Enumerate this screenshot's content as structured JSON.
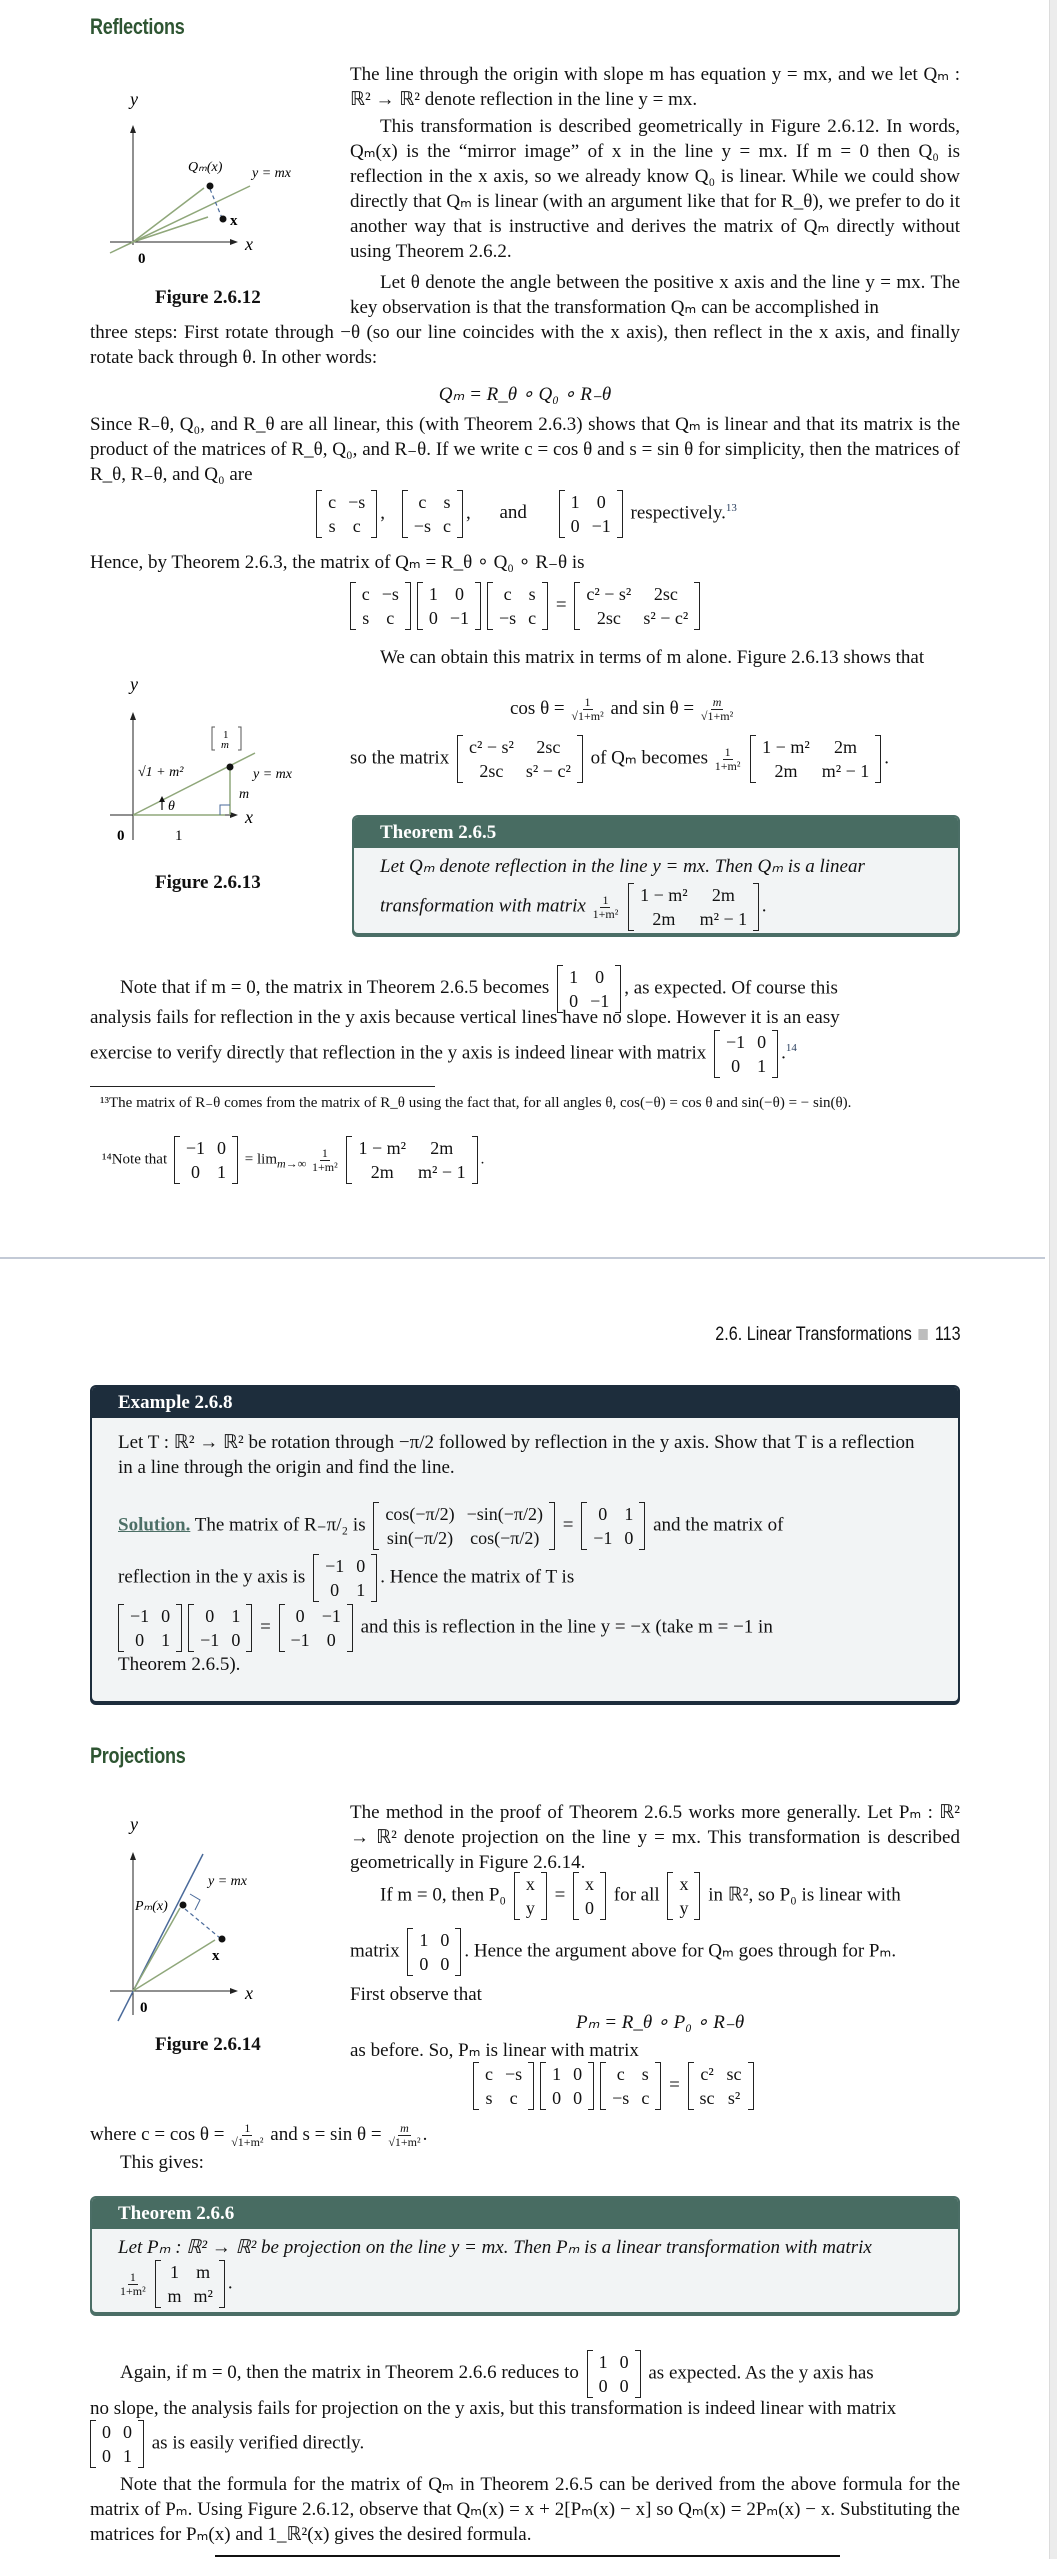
{
  "page1": {
    "section_title": "Reflections",
    "fig12": {
      "caption": "Figure 2.6.12",
      "labels": {
        "y": "y",
        "x": "x",
        "origin": "0",
        "qm": "Q_m(x)",
        "line": "y = mx",
        "point": "x"
      }
    },
    "p1": "The line through the origin with slope m has equation y = mx, and we let Qₘ : ℝ² → ℝ² denote reflection in the line y = mx.",
    "p2": "This transformation is described geometrically in Figure 2.6.12. In words, Qₘ(x) is the “mirror image” of x in the line y = mx. If m = 0 then Q₀ is reflection in the x axis, so we already know Q₀ is linear. While we could show directly that Qₘ is linear (with an argument like that for R_θ), we prefer to do it another way that is instructive and derives the matrix of Qₘ directly without using Theorem 2.6.2.",
    "p3a": "Let θ denote the angle between the positive x axis and the line y = mx. The key observation is that the transformation Qₘ can be accomplished in",
    "p3b": "three steps: First rotate through −θ (so our line coincides with the x axis), then reflect in the x axis, and finally rotate back through θ. In other words:",
    "eq1": "Qₘ = R_θ ∘ Q₀ ∘ R₋θ",
    "p4": "Since R₋θ, Q₀, and R_θ are all linear, this (with Theorem 2.6.3) shows that Qₘ is linear and that its matrix is the product of the matrices of R_θ, Q₀, and R₋θ. If we write c = cos θ and s = sin θ for simplicity, then the matrices of R_θ, R₋θ, and Q₀ are",
    "matrices_row": {
      "m1": [
        [
          "c",
          "−s"
        ],
        [
          "s",
          "c"
        ]
      ],
      "m2": [
        [
          "c",
          "s"
        ],
        [
          "−s",
          "c"
        ]
      ],
      "and": "and",
      "m3": [
        [
          "1",
          "0"
        ],
        [
          "0",
          "−1"
        ]
      ],
      "tail": "respectively.",
      "fn_mark": "13"
    },
    "p5": "Hence, by Theorem 2.6.3, the matrix of Qₘ = R_θ ∘ Q₀ ∘ R₋θ is",
    "product": {
      "a": [
        [
          "c",
          "−s"
        ],
        [
          "s",
          "c"
        ]
      ],
      "b": [
        [
          "1",
          "0"
        ],
        [
          "0",
          "−1"
        ]
      ],
      "c": [
        [
          "c",
          "s"
        ],
        [
          "−s",
          "c"
        ]
      ],
      "result": [
        [
          "c² − s²",
          "2sc"
        ],
        [
          "2sc",
          "s² − c²"
        ]
      ]
    },
    "p6": "We can obtain this matrix in terms of m alone. Figure 2.6.13 shows that",
    "cos_sin": {
      "cos_lhs": "cos θ =",
      "cos_num": "1",
      "cos_den": "√1+m²",
      "and": "and",
      "sin_lhs": "sin θ =",
      "sin_num": "m",
      "sin_den": "√1+m²"
    },
    "so_matrix": {
      "lead": "so the matrix",
      "m": [
        [
          "c² − s²",
          "2sc"
        ],
        [
          "2sc",
          "s² − c²"
        ]
      ],
      "mid": "of Qₘ becomes",
      "frac_num": "1",
      "frac_den": "1+m²",
      "result": [
        [
          "1 − m²",
          "2m"
        ],
        [
          "2m",
          "m² − 1"
        ]
      ]
    },
    "fig13": {
      "caption": "Figure 2.6.13",
      "labels": {
        "y": "y",
        "x": "x",
        "origin": "0",
        "one": "1",
        "vec_top": "1",
        "vec_bot": "m",
        "hyp": "√1 + m²",
        "line": "y = mx",
        "m": "m",
        "theta": "θ"
      }
    },
    "theorem265": {
      "title": "Theorem 2.6.5",
      "line1": "Let Qₘ denote reflection in the line y = mx. Then Qₘ is a linear",
      "line2": "transformation with matrix",
      "frac_num": "1",
      "frac_den": "1+m²",
      "matrix": [
        [
          "1 − m²",
          "2m"
        ],
        [
          "2m",
          "m² − 1"
        ]
      ]
    },
    "p7a": "Note that if m = 0, the matrix in Theorem 2.6.5 becomes",
    "p7_matrix": [
      [
        "1",
        "0"
      ],
      [
        "0",
        "−1"
      ]
    ],
    "p7b": ", as expected. Of course this",
    "p7c": "analysis fails for reflection in the y axis because vertical lines have no slope. However it is an easy",
    "p7d": "exercise to verify directly that reflection in the y axis is indeed linear with matrix",
    "p7_matrix2": [
      [
        "−1",
        "0"
      ],
      [
        "0",
        "1"
      ]
    ],
    "p7_fn_mark": "14",
    "fn13": "¹³The matrix of R₋θ comes from the matrix of R_θ using the fact that, for all angles θ, cos(−θ) = cos θ and sin(−θ) = − sin(θ).",
    "fn14": {
      "lead": "¹⁴Note that",
      "m1": [
        [
          "−1",
          "0"
        ],
        [
          "0",
          "1"
        ]
      ],
      "lim": "= lim",
      "lim_sub": "m→∞",
      "frac_num": "1",
      "frac_den": "1+m²",
      "m2": [
        [
          "1 − m²",
          "2m"
        ],
        [
          "2m",
          "m² − 1"
        ]
      ]
    }
  },
  "page2": {
    "running_head": "2.6. Linear Transformations",
    "page_number": "113",
    "example268": {
      "title": "Example 2.6.8",
      "statement": "Let T : ℝ² → ℝ² be rotation through −π/2 followed by reflection in the y axis. Show that T is a reflection in a line through the origin and find the line.",
      "solution_label": "Solution.",
      "sol_a": "The matrix of R₋π/₂ is",
      "rot_matrix": [
        [
          "cos(−π/2)",
          "−sin(−π/2)"
        ],
        [
          "sin(−π/2)",
          "cos(−π/2)"
        ]
      ],
      "rot_result": [
        [
          "0",
          "1"
        ],
        [
          "−1",
          "0"
        ]
      ],
      "sol_b": "and the matrix of",
      "sol_c": "reflection in the y axis is",
      "refl_matrix": [
        [
          "−1",
          "0"
        ],
        [
          "0",
          "1"
        ]
      ],
      "sol_d": ". Hence the matrix of T is",
      "prod_a": [
        [
          "−1",
          "0"
        ],
        [
          "0",
          "1"
        ]
      ],
      "prod_b": [
        [
          "0",
          "1"
        ],
        [
          "−1",
          "0"
        ]
      ],
      "prod_result": [
        [
          "0",
          "−1"
        ],
        [
          "−1",
          "0"
        ]
      ],
      "sol_e": "and this is reflection in the line y = −x (take m = −1 in",
      "sol_f": "Theorem 2.6.5)."
    },
    "section_title": "Projections",
    "fig14": {
      "caption": "Figure 2.6.14",
      "labels": {
        "y": "y",
        "x": "x",
        "origin": "0",
        "pm": "Pₘ(x)",
        "line": "y = mx",
        "point": "x"
      }
    },
    "q1": "The method in the proof of Theorem 2.6.5 works more generally. Let Pₘ : ℝ² → ℝ² denote projection on the line y = mx. This transformation is described geometrically in Figure 2.6.14.",
    "q2": {
      "lead": "If m = 0, then P₀",
      "v1": [
        [
          "x"
        ],
        [
          "y"
        ]
      ],
      "v2": [
        [
          "x"
        ],
        [
          "0"
        ]
      ],
      "forall": "for all",
      "v3": [
        [
          "x"
        ],
        [
          "y"
        ]
      ],
      "tail": "in ℝ², so P₀ is linear with"
    },
    "q3": {
      "lead": "matrix",
      "m": [
        [
          "1",
          "0"
        ],
        [
          "0",
          "0"
        ]
      ],
      "tail": ". Hence the argument above for Qₘ goes through for Pₘ."
    },
    "q4": "First observe that",
    "eq2": "Pₘ = R_θ ∘ P₀ ∘ R₋θ",
    "q5": "as before. So, Pₘ is linear with matrix",
    "product": {
      "a": [
        [
          "c",
          "−s"
        ],
        [
          "s",
          "c"
        ]
      ],
      "b": [
        [
          "1",
          "0"
        ],
        [
          "0",
          "0"
        ]
      ],
      "c": [
        [
          "c",
          "s"
        ],
        [
          "−s",
          "c"
        ]
      ],
      "result": [
        [
          "c²",
          "sc"
        ],
        [
          "sc",
          "s²"
        ]
      ]
    },
    "q6": {
      "lead": "where c = cos θ =",
      "c_num": "1",
      "c_den": "√1+m²",
      "mid": "and s = sin θ =",
      "s_num": "m",
      "s_den": "√1+m²"
    },
    "q7": "This gives:",
    "theorem266": {
      "title": "Theorem 2.6.6",
      "line1": "Let Pₘ : ℝ² → ℝ² be projection on the line y = mx. Then Pₘ is a linear transformation with matrix",
      "frac_num": "1",
      "frac_den": "1+m²",
      "matrix": [
        [
          "1",
          "m"
        ],
        [
          "m",
          "m²"
        ]
      ]
    },
    "r1a": "Again, if m = 0, then the matrix in Theorem 2.6.6 reduces to",
    "r1_matrix": [
      [
        "1",
        "0"
      ],
      [
        "0",
        "0"
      ]
    ],
    "r1b": "as expected. As the y axis has",
    "r1c": "no slope, the analysis fails for projection on the y axis, but this transformation is indeed linear with matrix",
    "r1_matrix2": [
      [
        "0",
        "0"
      ],
      [
        "0",
        "1"
      ]
    ],
    "r1d": "as is easily verified directly.",
    "r2": "Note that the formula for the matrix of Qₘ in Theorem 2.6.5 can be derived from the above formula for the matrix of Pₘ. Using Figure 2.6.12, observe that Qₘ(x) = x + 2[Pₘ(x) − x] so Qₘ(x) = 2Pₘ(x) − x. Substituting the matrices for Pₘ(x) and 1_ℝ²(x) gives the desired formula."
  },
  "colors": {
    "section_title": "#2e5532",
    "theorem_header": "#486c62",
    "example_header": "#1d2d3c",
    "box_bg": "#f2f4f5",
    "figure_green": "#8fa77a",
    "figure_blue": "#4a6a9a"
  }
}
